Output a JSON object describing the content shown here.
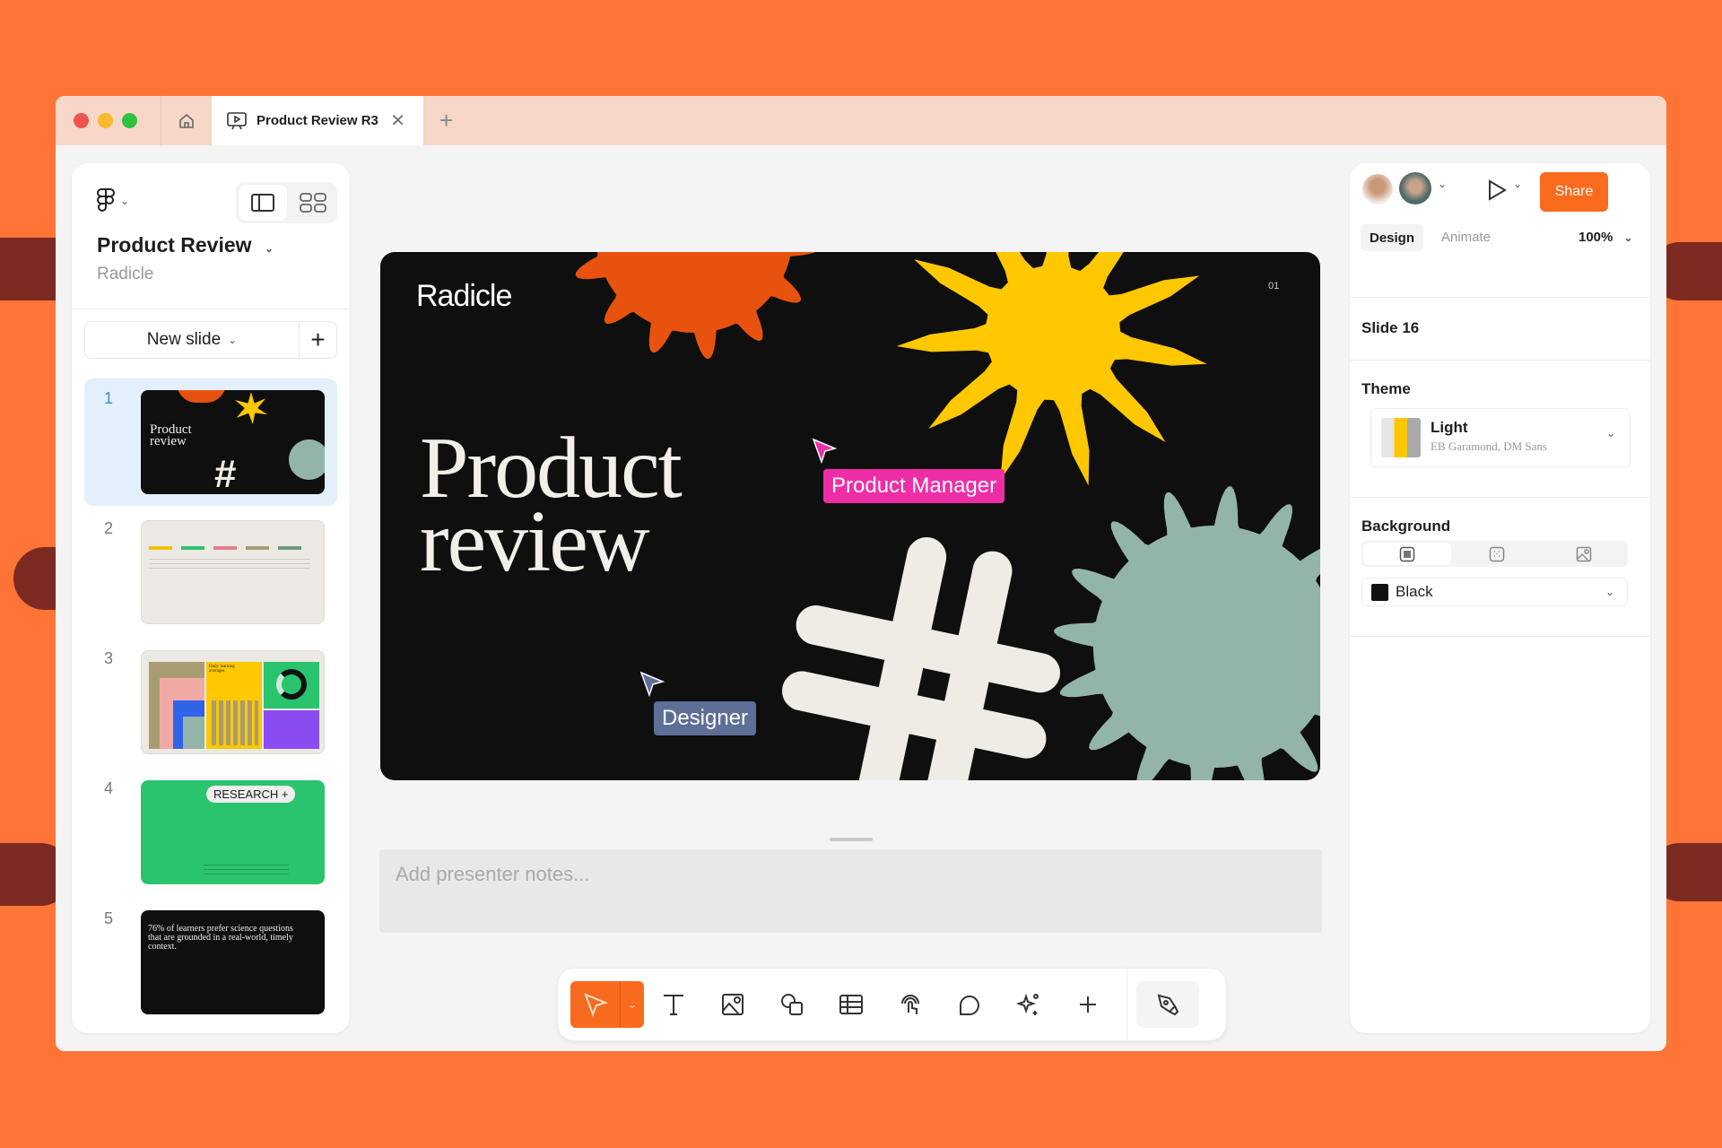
{
  "colors": {
    "background": "#fd7436",
    "accent": "#fb6b1e",
    "selection": "#e3f0fb",
    "pm_cursor": "#ee2ea7",
    "designer_cursor": "#5e6e96"
  },
  "tabbar": {
    "tab_title": "Product Review R3",
    "tab_icon": "presentation-icon",
    "new_tab": "+",
    "close": "✕"
  },
  "left_panel": {
    "title": "Product Review",
    "subtitle": "Radicle",
    "new_slide_label": "New slide",
    "add": "+",
    "slides": [
      {
        "number": "1",
        "selected": true,
        "kind": "title"
      },
      {
        "number": "2",
        "selected": false,
        "kind": "table"
      },
      {
        "number": "3",
        "selected": false,
        "kind": "charts",
        "caption": "Daily learning averages"
      },
      {
        "number": "4",
        "selected": false,
        "kind": "research",
        "badge": "RESEARCH +"
      },
      {
        "number": "5",
        "selected": false,
        "kind": "quote",
        "quote": "76% of learners prefer science questions that are grounded in a real-world, timely context."
      }
    ]
  },
  "slide": {
    "brand": "Radicle",
    "page": "01",
    "title_line1": "Product",
    "title_line2": "review"
  },
  "cursors": [
    {
      "label": "Product Manager"
    },
    {
      "label": "Designer"
    }
  ],
  "notes": {
    "placeholder": "Add presenter notes..."
  },
  "toolbar": {
    "tools": [
      "select-icon",
      "text-icon",
      "image-icon",
      "shapes-icon",
      "table-icon",
      "interaction-icon",
      "comment-icon",
      "ai-sparkle-icon",
      "plus-icon",
      "pen-icon"
    ]
  },
  "right_panel": {
    "share": "Share",
    "tabs": {
      "design": "Design",
      "animate": "Animate"
    },
    "zoom": "100%",
    "slide_name": "Slide 16",
    "theme": {
      "heading": "Theme",
      "name": "Light",
      "fonts": "EB Garamond, DM Sans"
    },
    "background": {
      "heading": "Background",
      "color_name": "Black",
      "color": "#111111"
    }
  }
}
